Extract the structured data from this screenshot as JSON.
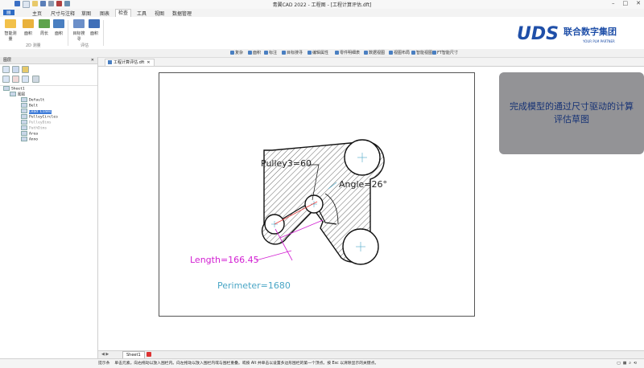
{
  "window": {
    "title": "青翼CAD 2022 - 工程图 - [工程计算评估.dft]"
  },
  "menu": {
    "tabs": [
      "主页",
      "尺寸与注释",
      "草图",
      "图表",
      "检查",
      "工具",
      "视图",
      "数据管理"
    ],
    "active_tab": "检查"
  },
  "ribbon": {
    "buttons": [
      "智能测量",
      "面积",
      "周长",
      "面积",
      "目标搜寻",
      "面积"
    ],
    "groups": [
      "2D 测量",
      "评估"
    ]
  },
  "logo": {
    "brand": "UDS",
    "name": "联合数字集团",
    "tagline": "YOUR PLM PARTNER",
    "color": "#1f4fa8"
  },
  "toolbar2": {
    "items": [
      "复杂",
      "面积",
      "标注",
      "目标搜寻",
      "编辑属性",
      "零件明细表",
      "数据视图",
      "视图布局",
      "智能视图",
      "FT智能尺寸"
    ]
  },
  "left_panel": {
    "title": "图层",
    "tree": [
      {
        "label": "Sheet1",
        "level": 0
      },
      {
        "label": "图层",
        "level": 1
      },
      {
        "label": "Default",
        "level": 2
      },
      {
        "label": "Belt",
        "level": 2
      },
      {
        "label": "Lead Lines",
        "level": 2,
        "selected": true
      },
      {
        "label": "PulleyCircles",
        "level": 2
      },
      {
        "label": "PulleyDims",
        "level": 2
      },
      {
        "label": "PathDims",
        "level": 2
      },
      {
        "label": "Area",
        "level": 2
      },
      {
        "label": "Anno",
        "level": 2
      }
    ]
  },
  "document": {
    "tab_label": "工程计算评估.dft",
    "sheet_tab": "Sheet1"
  },
  "drawing": {
    "pulley_dim": "Pulley3=60",
    "angle_dim": "Angle=26°",
    "length_dim": "Length=166.45",
    "perimeter_dim": "Perimeter=1680",
    "colors": {
      "accent": "#d21fd2",
      "perimeter": "#4aa6c6",
      "hatch": "#222222",
      "construction": "#e83c3c"
    }
  },
  "callout": {
    "text": "完成模型的通过尺寸驱动的计算评估草图"
  },
  "status": {
    "prompt_label": "提示条",
    "text": "单击元素。向右拖动以放入围栏内。向左拖动以放入围栏内或与围栏重叠。或按 Alt 并单击以设置多边形围栏的第一个顶点。按 Esc 以清除显示的关键点。"
  }
}
